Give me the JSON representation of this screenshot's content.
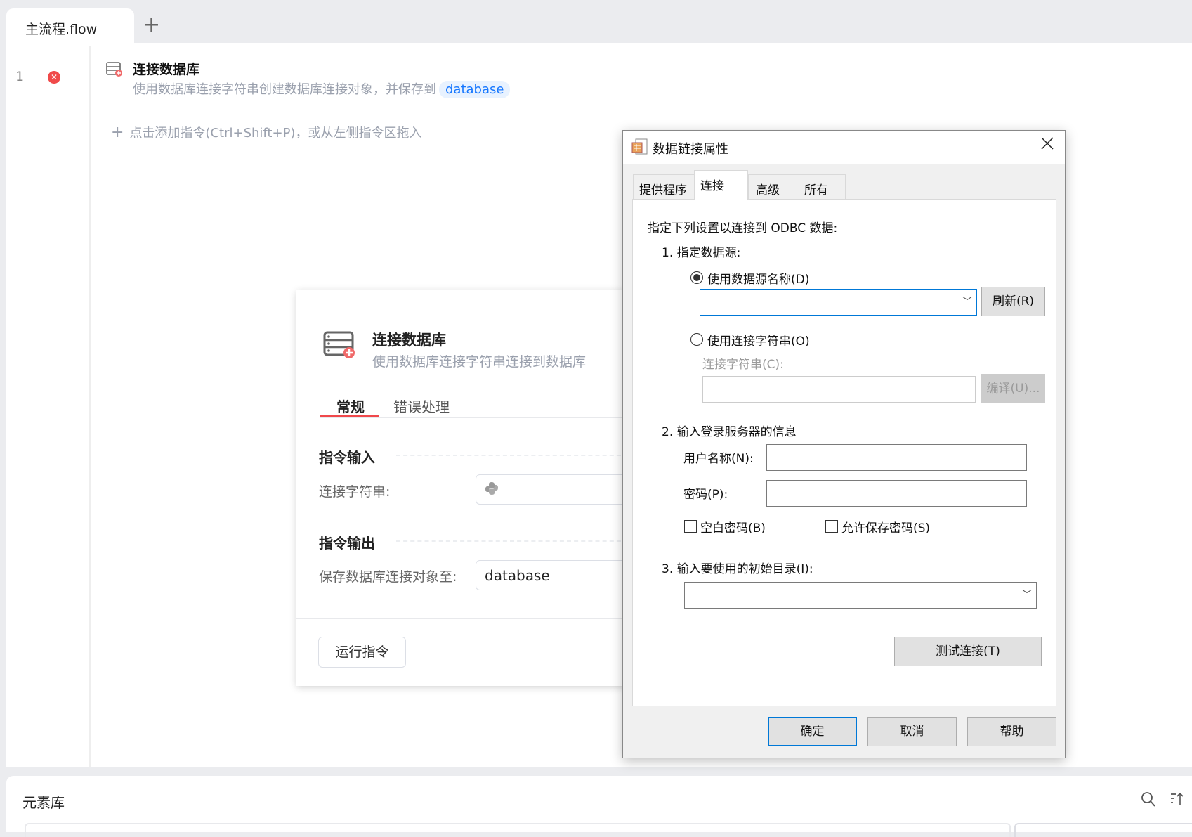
{
  "tabs": {
    "active": "主流程.flow",
    "add_label": "+"
  },
  "flow": {
    "line_number": "1",
    "error_icon": "✕",
    "step_title": "连接数据库",
    "step_desc": "使用数据库连接字符串创建数据库连接对象，并保存到",
    "step_var": "database",
    "add_hint": "点击添加指令(Ctrl+Shift+P)，或从左侧指令区拖入",
    "add_icon": "+"
  },
  "panel": {
    "title": "连接数据库",
    "subtitle": "使用数据库连接字符串连接到数据库",
    "tabs": [
      "常规",
      "错误处理"
    ],
    "input_section": "指令输入",
    "conn_label": "连接字符串:",
    "output_section": "指令输出",
    "save_label": "保存数据库连接对象至:",
    "save_value": "database",
    "run_button": "运行指令"
  },
  "dialog": {
    "title": "数据链接属性",
    "close": "✕",
    "tabs": [
      "提供程序",
      "连接",
      "高级",
      "所有"
    ],
    "intro": "指定下列设置以连接到 ODBC 数据:",
    "step1": "1. 指定数据源:",
    "radio_dsn": "使用数据源名称(D)",
    "refresh": "刷新(R)",
    "radio_connstr": "使用连接字符串(O)",
    "connstr_label": "连接字符串(C):",
    "compile": "编译(U)...",
    "step2": "2. 输入登录服务器的信息",
    "username_label": "用户名称(N):",
    "password_label": "密码(P):",
    "blank_password": "空白密码(B)",
    "allow_save_password": "允许保存密码(S)",
    "step3": "3. 输入要使用的初始目录(I):",
    "test": "测试连接(T)",
    "ok": "确定",
    "cancel": "取消",
    "help": "帮助"
  },
  "bottom": {
    "title": "元素库"
  },
  "colors": {
    "accent": "#1677ff",
    "error": "#f04a4a",
    "tab_underline": "#f0484b",
    "focus": "#0078d7"
  }
}
